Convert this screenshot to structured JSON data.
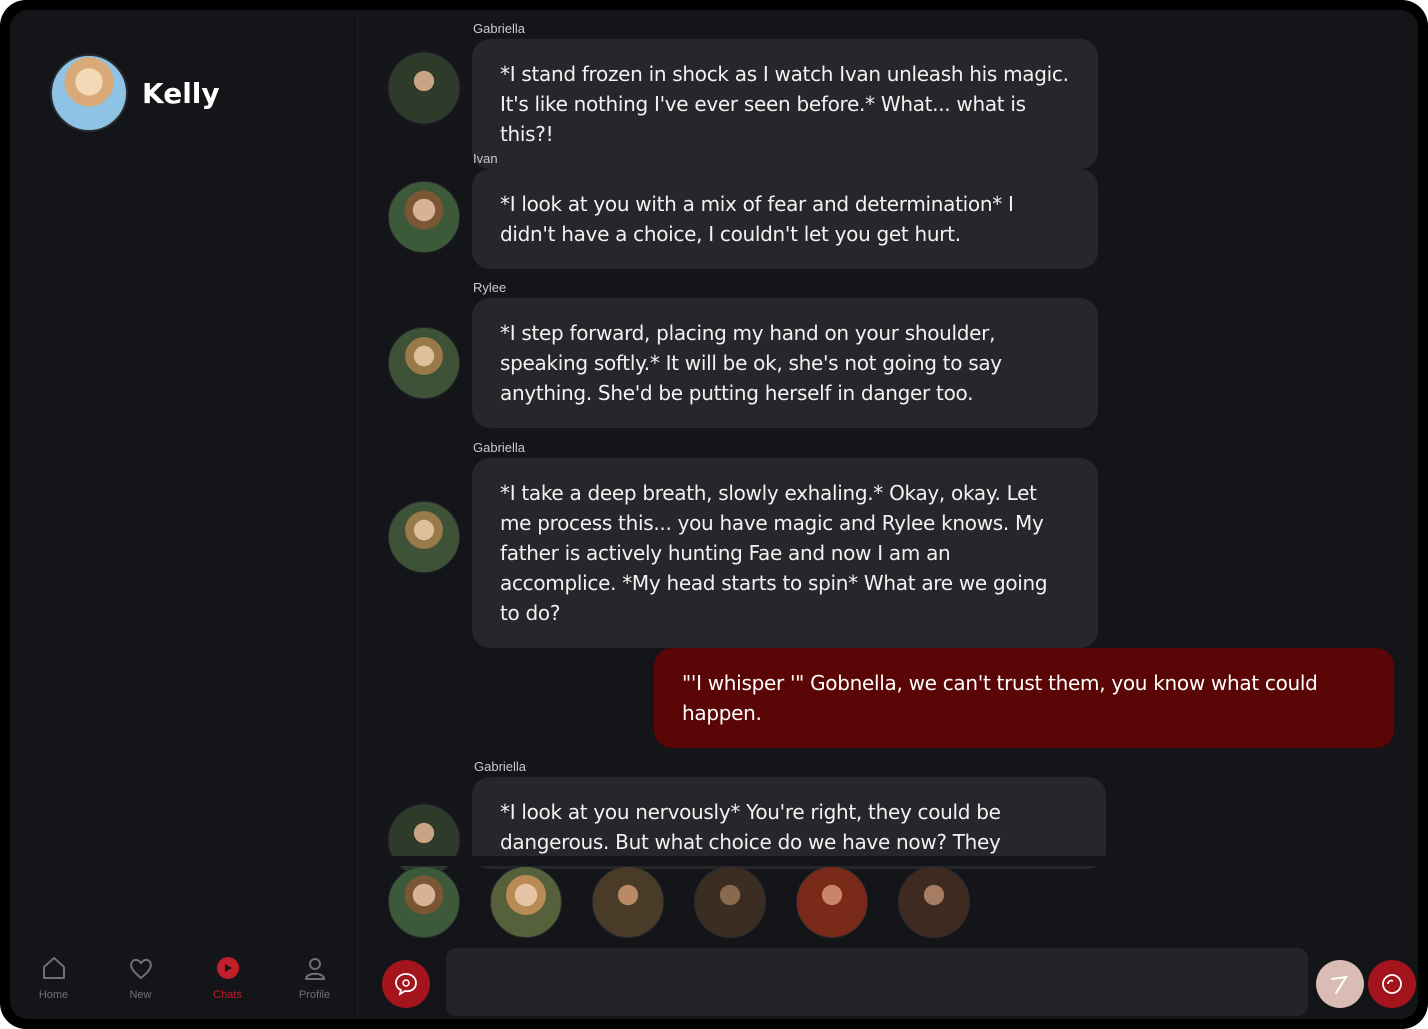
{
  "profile": {
    "name": "Kelly"
  },
  "nav": [
    {
      "label": "Home",
      "icon": "home-icon"
    },
    {
      "label": "New",
      "icon": "heart-icon"
    },
    {
      "label": "Chats",
      "icon": "chat-icon"
    },
    {
      "label": "Profile",
      "icon": "user-icon"
    }
  ],
  "messages": [
    {
      "sender": "Gabriella",
      "text": "*I stand frozen in shock as I watch Ivan unleash his magic. It's like nothing I've ever seen before.* What... what is this?!"
    },
    {
      "sender": "Ivan",
      "text": "*I look at you with a mix of fear and determination* I didn't have a choice, I couldn't let you get hurt."
    },
    {
      "sender": "Rylee",
      "text": "*I step forward, placing my hand on your shoulder, speaking softly.* It will be ok, she's not going to say anything. She'd be putting herself in danger too."
    },
    {
      "sender": "Gabriella",
      "text": "*I take a deep breath, slowly exhaling.* Okay, okay. Let me process this... you have magic and Rylee knows. My father is actively hunting Fae and now I am an accomplice. *My head starts to spin* What are we going to do?"
    },
    {
      "sender": "",
      "text": "\"'I whisper '\" Gobnella, we can't trust them, you know what could happen."
    },
    {
      "sender": "Gabriella",
      "text": "*I look at you nervously* You're right, they could be dangerous. But what choice do we have now? They"
    }
  ],
  "composer": {
    "placeholder": ""
  },
  "colors": {
    "accent": "#a3141d",
    "user_bubble": "#5a0606",
    "bot_bubble": "#26272b",
    "background": "#141518"
  }
}
